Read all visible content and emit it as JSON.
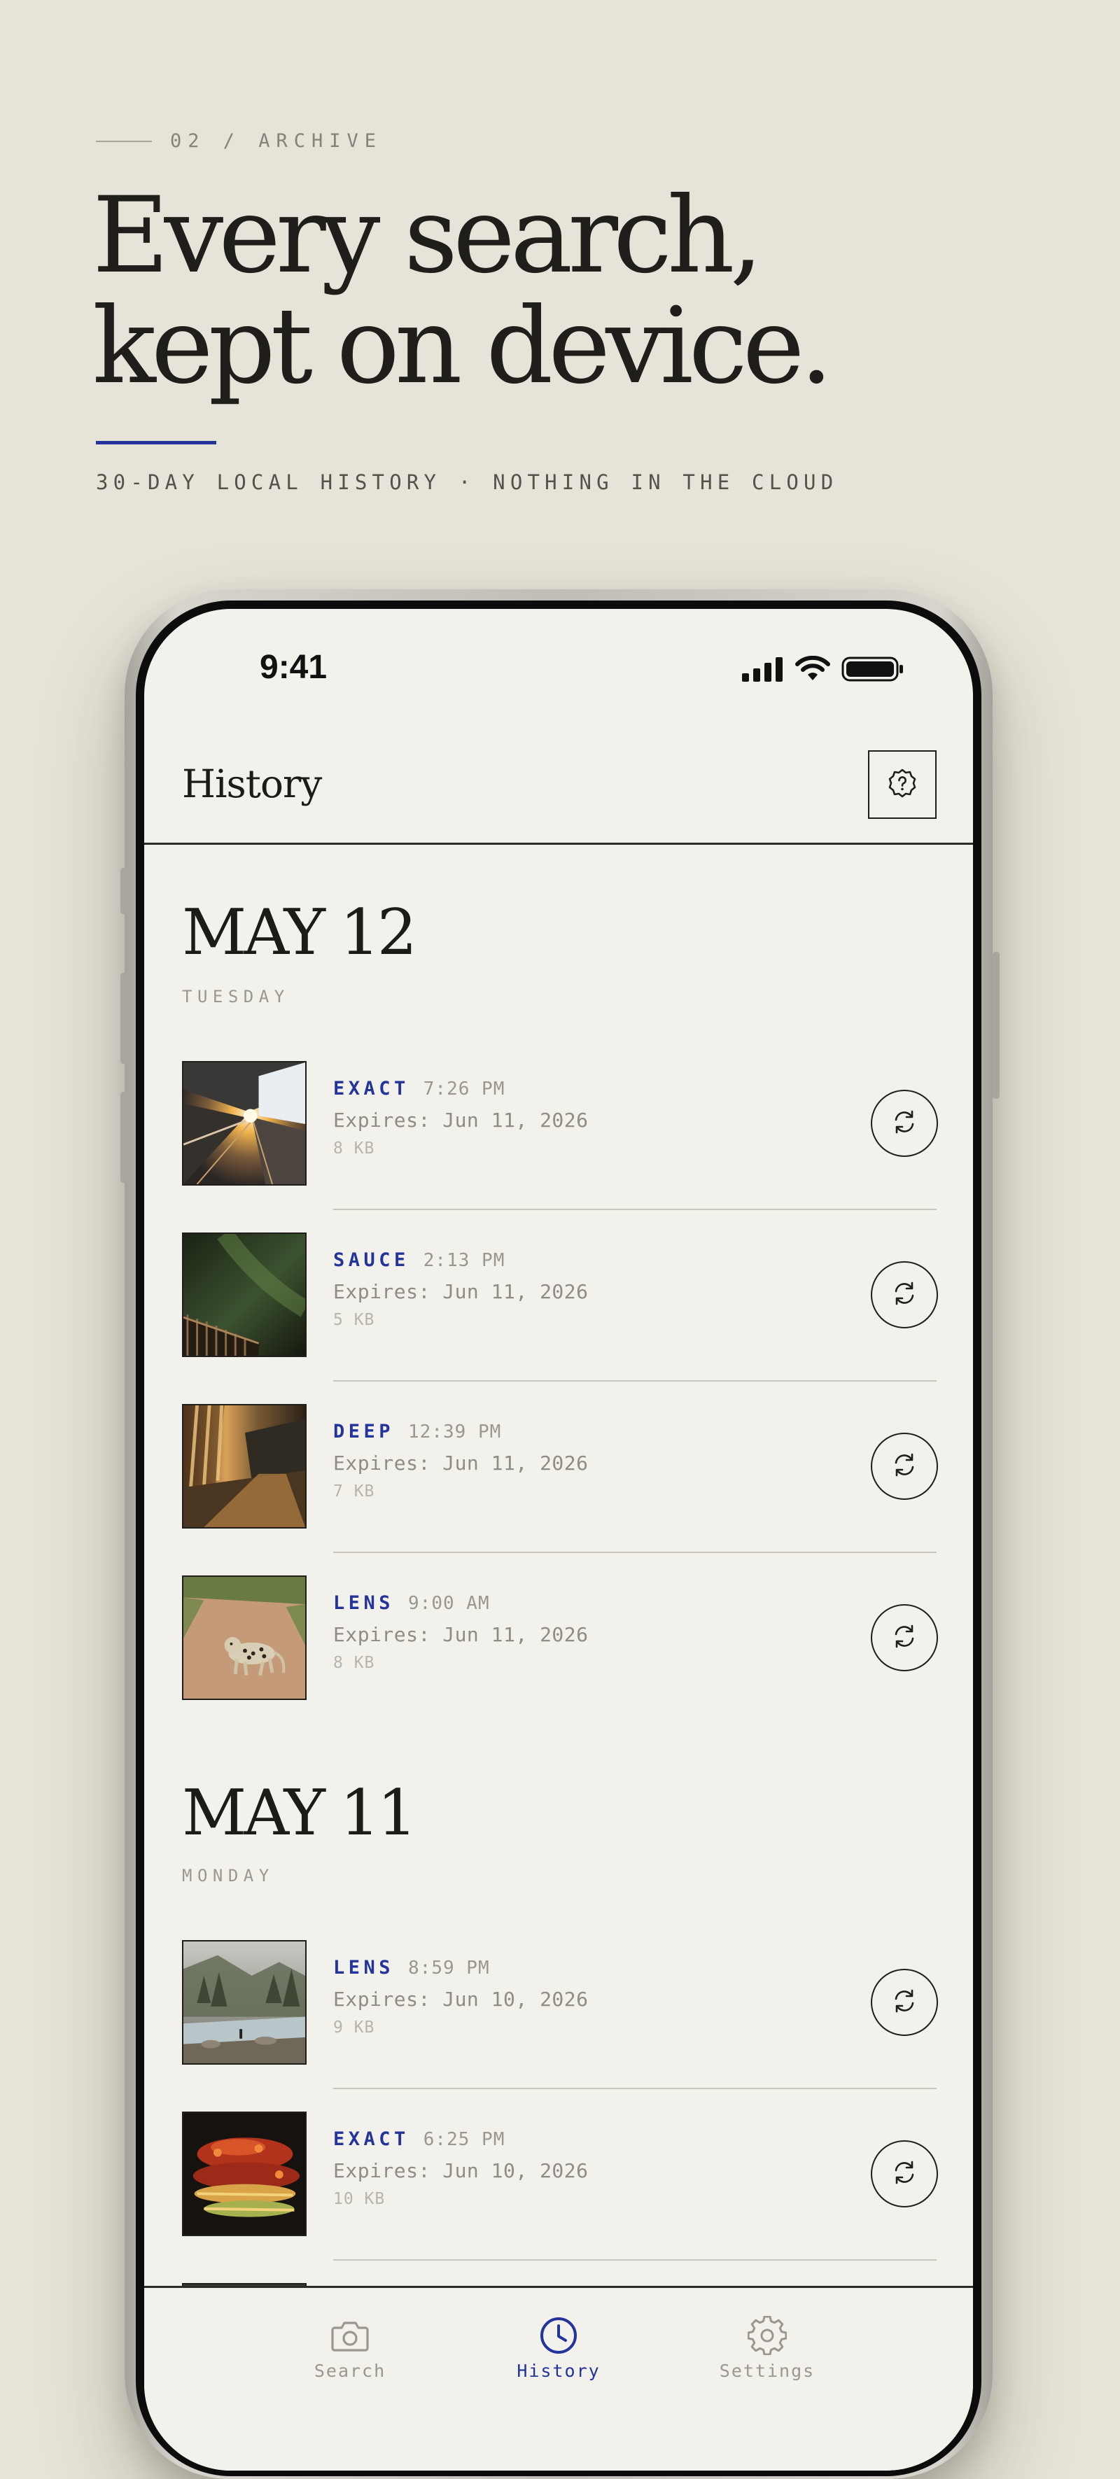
{
  "hero": {
    "kicker": "02 / ARCHIVE",
    "headline_line1": "Every search,",
    "headline_line2": "kept on device.",
    "tagline": "30-DAY LOCAL HISTORY · NOTHING IN THE CLOUD",
    "accent_color": "#23349a"
  },
  "status_bar": {
    "time": "9:41",
    "icons": [
      "cellular-signal-icon",
      "wifi-icon",
      "battery-icon"
    ]
  },
  "nav": {
    "title": "History",
    "help_icon": "question-badge-icon"
  },
  "sections": [
    {
      "date": "MAY 12",
      "day": "TUESDAY",
      "items": [
        {
          "mode": "EXACT",
          "time": "7:26 PM",
          "expires": "Expires: Jun 11, 2026",
          "size": "8 KB",
          "thumb": "train-platform-sunset"
        },
        {
          "mode": "SAUCE",
          "time": "2:13 PM",
          "expires": "Expires: Jun 11, 2026",
          "size": "5 KB",
          "thumb": "night-sky-fence"
        },
        {
          "mode": "DEEP",
          "time": "12:39 PM",
          "expires": "Expires: Jun 11, 2026",
          "size": "7 KB",
          "thumb": "sunlit-corridor"
        },
        {
          "mode": "LENS",
          "time": "9:00 AM",
          "expires": "Expires: Jun 11, 2026",
          "size": "8 KB",
          "thumb": "leopard-on-road"
        }
      ]
    },
    {
      "date": "MAY 11",
      "day": "MONDAY",
      "items": [
        {
          "mode": "LENS",
          "time": "8:59 PM",
          "expires": "Expires: Jun 10, 2026",
          "size": "9 KB",
          "thumb": "misty-river-valley"
        },
        {
          "mode": "EXACT",
          "time": "6:25 PM",
          "expires": "Expires: Jun 10, 2026",
          "size": "10 KB",
          "thumb": "grilled-food"
        }
      ]
    }
  ],
  "tabs": [
    {
      "label": "Search",
      "icon": "camera-icon",
      "active": false
    },
    {
      "label": "History",
      "icon": "clock-icon",
      "active": true
    },
    {
      "label": "Settings",
      "icon": "gear-icon",
      "active": false
    }
  ],
  "colors": {
    "background": "#e6e3d8",
    "screen": "#f3f1eb",
    "accent": "#23349a",
    "ink": "#1c1b18"
  }
}
